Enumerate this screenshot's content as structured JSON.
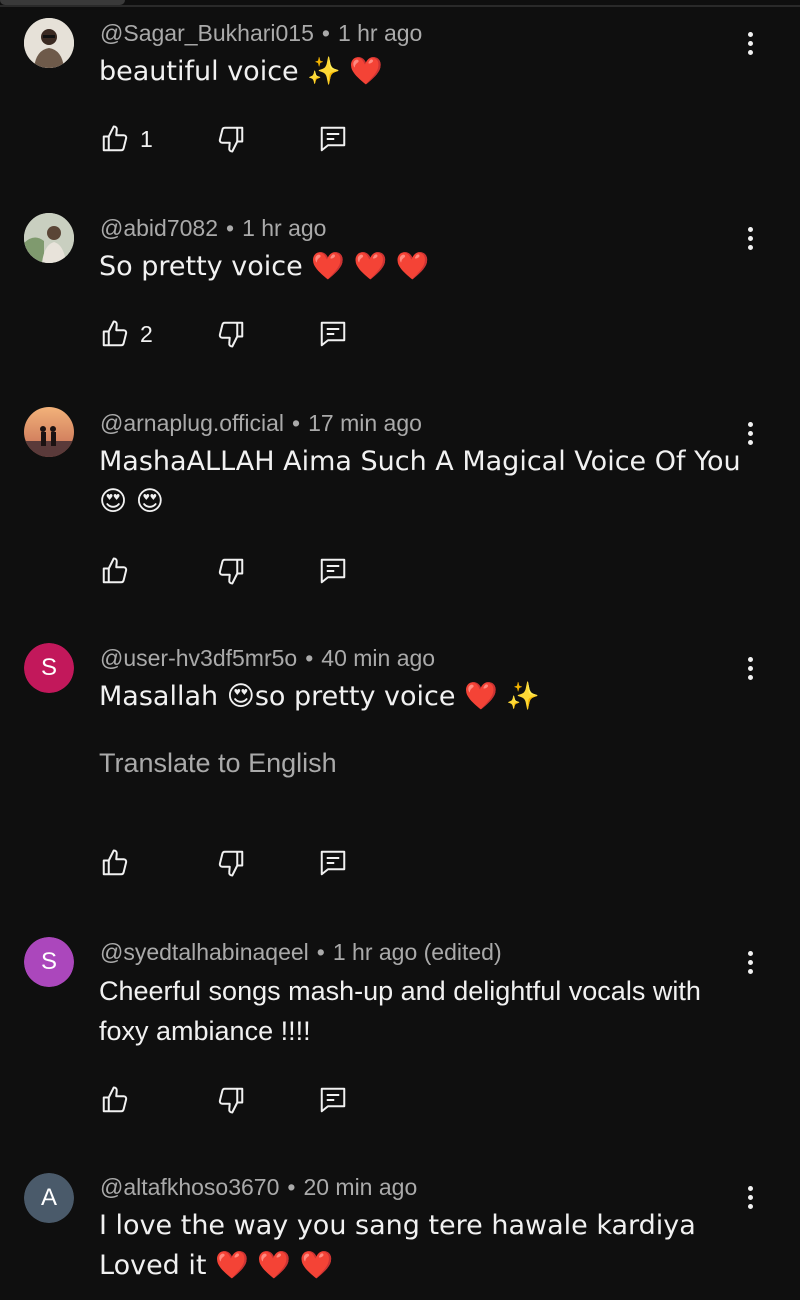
{
  "comments": [
    {
      "username": "@Sagar_Bukhari015",
      "separator": "•",
      "time": "1 hr ago",
      "text": "beautiful voice ✨ ❤️",
      "likes": "1",
      "avatar_icon": "person-photo"
    },
    {
      "username": "@abid7082",
      "separator": "•",
      "time": "1 hr ago",
      "text": "So pretty voice ❤️ ❤️ ❤️",
      "likes": "2",
      "avatar_icon": "person-photo"
    },
    {
      "username": "@arnaplug.official",
      "separator": "•",
      "time": "17 min ago",
      "text": "MashaALLAH Aima Such A Magical Voice Of You 😍 😍",
      "likes": "",
      "avatar_icon": "couple-sunset-photo"
    },
    {
      "username": "@user-hv3df5mr5o",
      "separator": "•",
      "time": "40 min ago",
      "text": "Masallah 😍so pretty voice ❤️ ✨",
      "likes": "",
      "avatar_letter": "S",
      "avatar_color": "#c2185b",
      "translate_label": "Translate to English"
    },
    {
      "username": "@syedtalhabinaqeel",
      "separator": "•",
      "time": "1 hr ago (edited)",
      "text": "Cheerful songs mash-up and delightful vocals with foxy ambiance !!!!",
      "likes": "",
      "avatar_letter": "S",
      "avatar_color": "#ab47bc"
    },
    {
      "username": "@altafkhoso3670",
      "separator": "•",
      "time": "20 min ago",
      "text": "I love the way you sang tere hawale kardiya Loved it ❤️ ❤️ ❤️",
      "likes": "",
      "avatar_letter": "A",
      "avatar_color": "#4a5a6a"
    }
  ],
  "icons": {
    "like": "thumbs-up-icon",
    "dislike": "thumbs-down-icon",
    "reply": "reply-comment-icon",
    "menu": "more-vertical-icon"
  }
}
